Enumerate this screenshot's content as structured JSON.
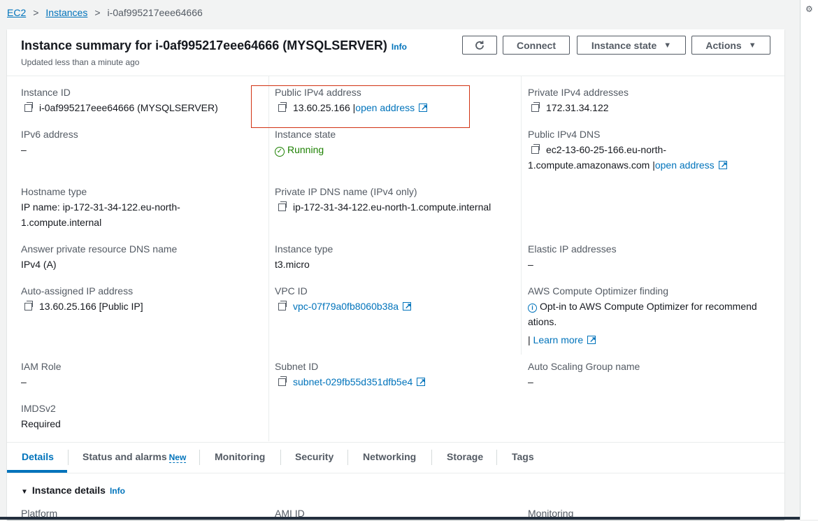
{
  "breadcrumb": {
    "ec2": "EC2",
    "instances": "Instances",
    "current": "i-0af995217eee64666",
    "sep": ">"
  },
  "header": {
    "title": "Instance summary for i-0af995217eee64666 (MYSQLSERVER)",
    "info": "Info",
    "subtitle": "Updated less than a minute ago",
    "refresh_icon": "refresh-icon",
    "connect": "Connect",
    "instance_state": "Instance state",
    "actions": "Actions"
  },
  "fields": {
    "instance_id": {
      "label": "Instance ID",
      "value": "i-0af995217eee64666 (MYSQLSERVER)"
    },
    "public_ipv4": {
      "label": "Public IPv4 address",
      "value": "13.60.25.166",
      "link": "open address"
    },
    "private_ipv4": {
      "label": "Private IPv4 addresses",
      "value": "172.31.34.122"
    },
    "ipv6": {
      "label": "IPv6 address",
      "value": "–"
    },
    "instance_state": {
      "label": "Instance state",
      "value": "Running"
    },
    "public_dns": {
      "label": "Public IPv4 DNS",
      "line1": "ec2-13-60-25-166.eu-north-",
      "line2": "1.compute.amazonaws.com",
      "link": "open address"
    },
    "hostname_type": {
      "label": "Hostname type",
      "line1": "IP name: ip-172-31-34-122.eu-north-",
      "line2": "1.compute.internal"
    },
    "private_dns": {
      "label": "Private IP DNS name (IPv4 only)",
      "value": "ip-172-31-34-122.eu-north-1.compute.internal"
    },
    "answer_dns": {
      "label": "Answer private resource DNS name",
      "value": "IPv4 (A)"
    },
    "instance_type": {
      "label": "Instance type",
      "value": "t3.micro"
    },
    "elastic_ip": {
      "label": "Elastic IP addresses",
      "value": "–"
    },
    "auto_ip": {
      "label": "Auto-assigned IP address",
      "value": "13.60.25.166 [Public IP]"
    },
    "vpc_id": {
      "label": "VPC ID",
      "value": "vpc-07f79a0fb8060b38a"
    },
    "optimizer": {
      "label": "AWS Compute Optimizer finding",
      "line1": "Opt-in to AWS Compute Optimizer for recommend",
      "line2": "ations.",
      "learn": "Learn more"
    },
    "iam_role": {
      "label": "IAM Role",
      "value": "–"
    },
    "subnet_id": {
      "label": "Subnet ID",
      "value": "subnet-029fb55d351dfb5e4"
    },
    "asg": {
      "label": "Auto Scaling Group name",
      "value": "–"
    },
    "imdsv2": {
      "label": "IMDSv2",
      "value": "Required"
    }
  },
  "tabs": [
    "Details",
    "Status and alarms",
    "Monitoring",
    "Security",
    "Networking",
    "Storage",
    "Tags"
  ],
  "tab_new_badge": "New",
  "section": {
    "title": "Instance details",
    "info": "Info",
    "platform": "Platform",
    "ami_id": "AMI ID",
    "monitoring": "Monitoring"
  },
  "colors": {
    "link": "#0073bb",
    "running": "#1d8102",
    "highlight": "#d13212"
  }
}
